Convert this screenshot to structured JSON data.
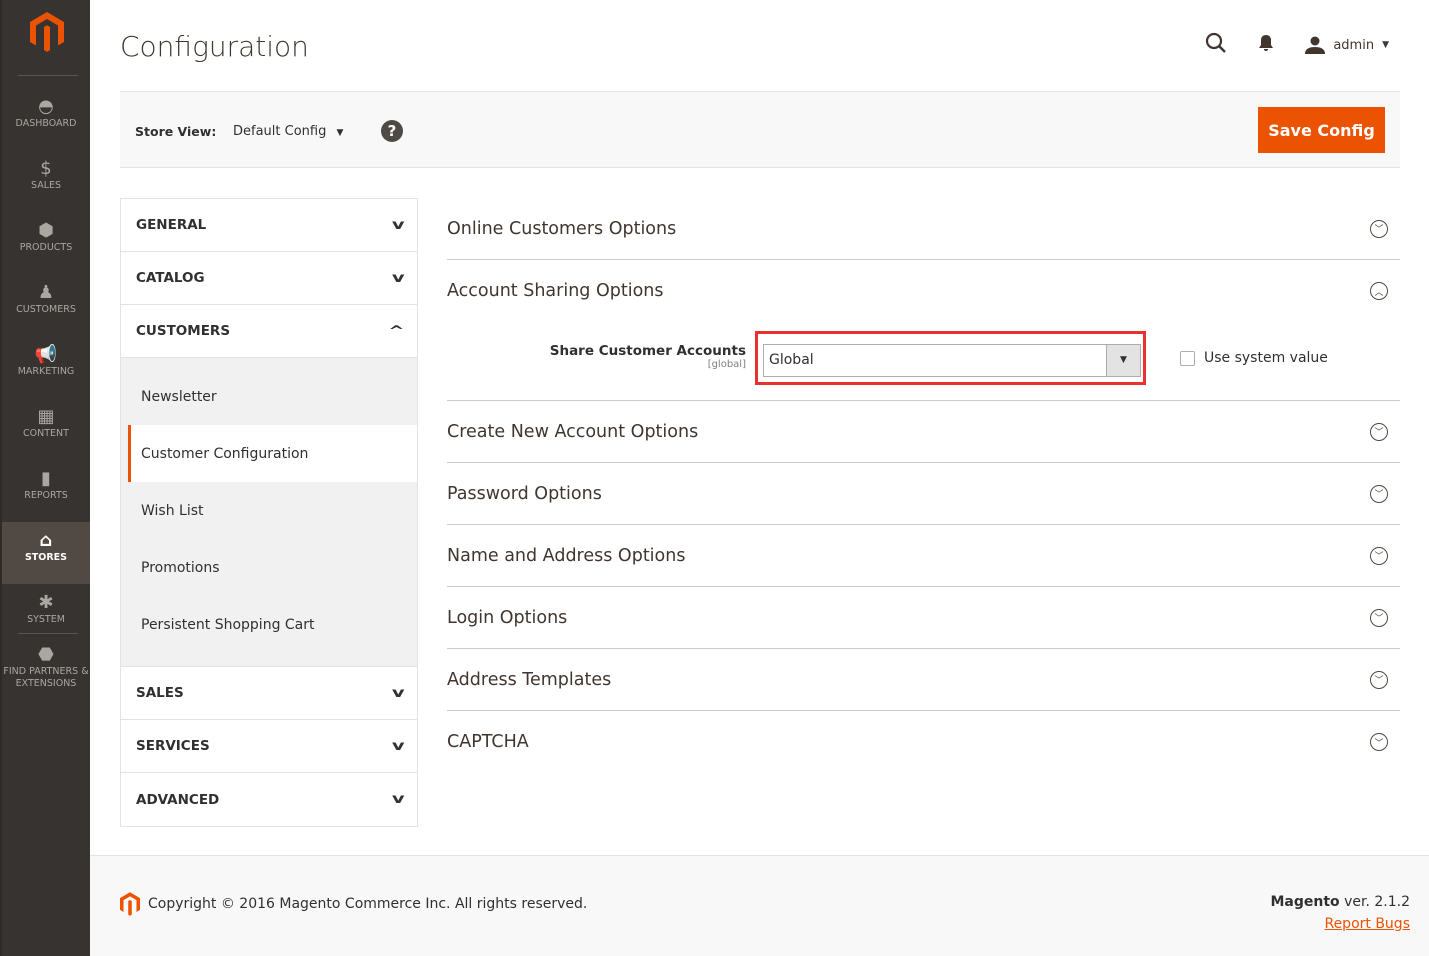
{
  "sidebar": {
    "items": [
      {
        "label": "DASHBOARD",
        "icon": "gauge-icon"
      },
      {
        "label": "SALES",
        "icon": "dollar-icon"
      },
      {
        "label": "PRODUCTS",
        "icon": "box-icon"
      },
      {
        "label": "CUSTOMERS",
        "icon": "person-icon"
      },
      {
        "label": "MARKETING",
        "icon": "megaphone-icon"
      },
      {
        "label": "CONTENT",
        "icon": "layout-icon"
      },
      {
        "label": "REPORTS",
        "icon": "bar-chart-icon"
      },
      {
        "label": "STORES",
        "icon": "storefront-icon",
        "active": true
      },
      {
        "label": "SYSTEM",
        "icon": "gear-icon"
      },
      {
        "label": "FIND PARTNERS & EXTENSIONS",
        "icon": "blocks-icon"
      }
    ]
  },
  "header": {
    "title": "Configuration",
    "user": "admin"
  },
  "toolbar": {
    "store_view_label": "Store View:",
    "store_view_value": "Default Config",
    "save_label": "Save Config"
  },
  "tabs": {
    "groups": [
      "GENERAL",
      "CATALOG",
      "CUSTOMERS",
      "SALES",
      "SERVICES",
      "ADVANCED"
    ],
    "customers_items": [
      "Newsletter",
      "Customer Configuration",
      "Wish List",
      "Promotions",
      "Persistent Shopping Cart"
    ],
    "active_item": "Customer Configuration"
  },
  "sections": [
    "Online Customers Options",
    "Account Sharing Options",
    "Create New Account Options",
    "Password Options",
    "Name and Address Options",
    "Login Options",
    "Address Templates",
    "CAPTCHA"
  ],
  "field": {
    "label": "Share Customer Accounts",
    "scope": "[global]",
    "value": "Global",
    "use_system_value": "Use system value",
    "use_system_checked": false
  },
  "footer": {
    "copyright": "Copyright © 2016 Magento Commerce Inc. All rights reserved.",
    "brand": "Magento",
    "version": " ver. 2.1.2",
    "report_bugs": "Report Bugs"
  },
  "colors": {
    "accent": "#eb5202",
    "sidebar": "#373330",
    "highlight": "#ea3030"
  }
}
